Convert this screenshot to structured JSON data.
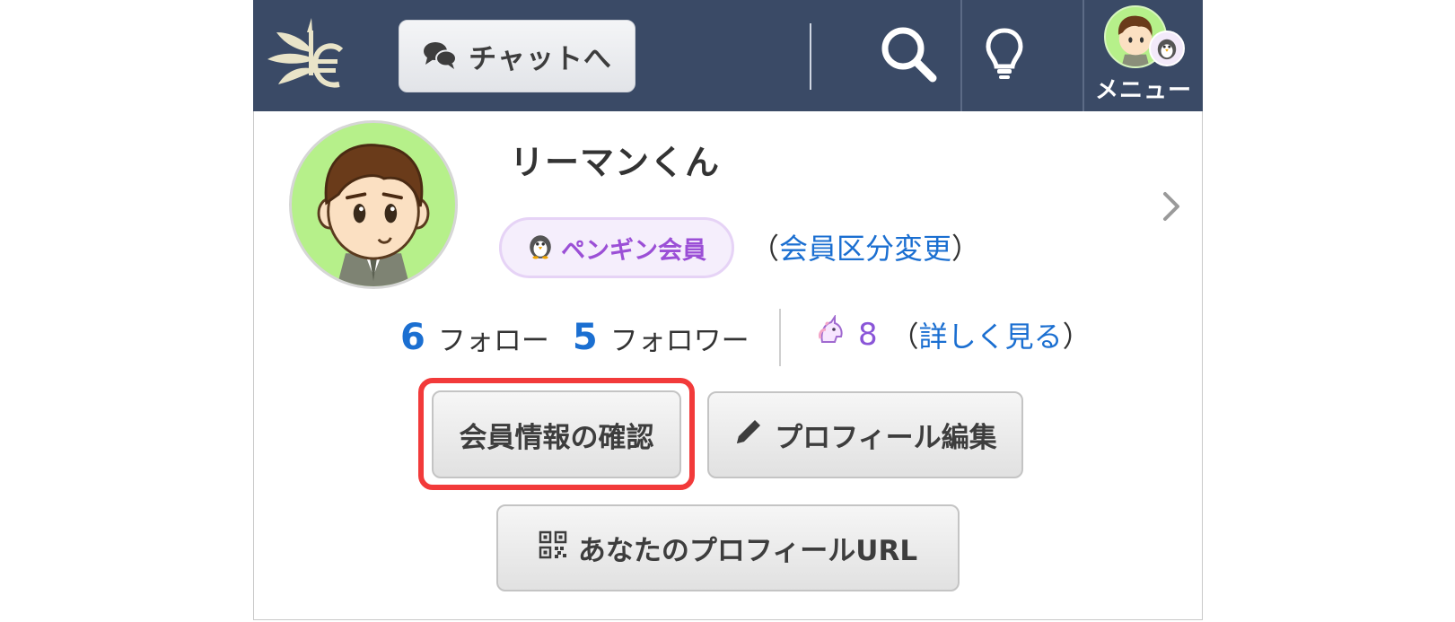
{
  "header": {
    "logo_icon": "wheat-euro-logo-icon",
    "chat_button_label": "チャットへ",
    "chat_icon": "chat-bubbles-icon",
    "search_icon": "search-icon",
    "hint_icon": "lightbulb-icon",
    "menu_label": "メニュー"
  },
  "profile": {
    "username": "リーマンくん",
    "member_badge": "ペンギン会員",
    "member_change_open": "（",
    "member_change_link": "会員区分変更",
    "member_change_close": "）",
    "follow_count": "6",
    "follow_label": "フォロー",
    "follower_count": "5",
    "follower_label": "フォロワー",
    "kudos_count": "8",
    "details_open": "（",
    "details_link": "詳しく見る",
    "details_close": "）"
  },
  "actions": {
    "member_info_button": "会員情報の確認",
    "edit_profile_button": "プロフィール編集",
    "profile_url_button": "あなたのプロフィールURL"
  },
  "colors": {
    "navbar": "#3a4a66",
    "link": "#1b6fd1",
    "badge_text": "#9b4fd6",
    "highlight": "#f23a3a"
  }
}
